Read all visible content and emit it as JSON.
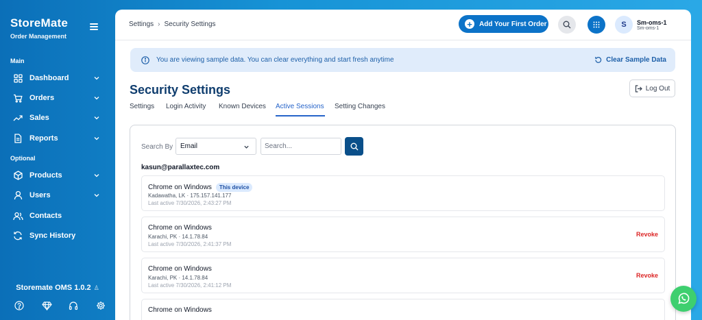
{
  "brand": {
    "name": "StoreMate",
    "subtitle": "Order Management"
  },
  "sidebar": {
    "sections": [
      {
        "label": "Main"
      },
      {
        "label": "Optional"
      }
    ],
    "items": [
      {
        "label": "Dashboard",
        "icon": "grid-icon",
        "has_chevron": true
      },
      {
        "label": "Orders",
        "icon": "cart-icon",
        "has_chevron": true
      },
      {
        "label": "Sales",
        "icon": "trending-up-icon",
        "has_chevron": true
      },
      {
        "label": "Reports",
        "icon": "document-icon",
        "has_chevron": true
      },
      {
        "label": "Products",
        "icon": "box-icon",
        "has_chevron": true
      },
      {
        "label": "Users",
        "icon": "user-icon",
        "has_chevron": true
      },
      {
        "label": "Contacts",
        "icon": "contacts-icon",
        "has_chevron": false
      },
      {
        "label": "Sync History",
        "icon": "sync-icon",
        "has_chevron": false
      }
    ],
    "version": "Storemate OMS 1.0.2",
    "bottom_icons": [
      "help-icon",
      "diamond-icon",
      "headset-icon",
      "settings-icon"
    ]
  },
  "header": {
    "breadcrumb": [
      "Settings",
      "Security Settings"
    ],
    "add_order_label": "Add Your First Order",
    "user_name": "Sm-oms-1",
    "user_sub": "Sm-oms-1",
    "avatar_initial": "S"
  },
  "banner": {
    "text": "You are viewing sample data. You can clear everything and start fresh anytime",
    "clear_label": "Clear Sample Data"
  },
  "page": {
    "title": "Security Settings",
    "logout_label": "Log Out",
    "tabs": [
      {
        "label": "Settings",
        "active": false
      },
      {
        "label": "Login Activity",
        "active": false
      },
      {
        "label": "Known Devices",
        "active": false
      },
      {
        "label": "Active Sessions",
        "active": true
      },
      {
        "label": "Setting Changes",
        "active": false
      }
    ]
  },
  "filters": {
    "search_by_label": "Search By",
    "selected_field": "Email",
    "search_placeholder": "Search..."
  },
  "sessions": {
    "email": "kasun@parallaxtec.com",
    "items": [
      {
        "device": "Chrome on Windows",
        "badge": "This device",
        "location": "Kadawatha, LK · 175.157.141.177",
        "last_active": "Last active 7/30/2026, 2:43:27 PM",
        "action": ""
      },
      {
        "device": "Chrome on Windows",
        "badge": "",
        "location": "Karachi, PK · 14.1.78.84",
        "last_active": "Last active 7/30/2026, 2:41:37 PM",
        "action": "Revoke"
      },
      {
        "device": "Chrome on Windows",
        "badge": "",
        "location": "Karachi, PK · 14.1.78.84",
        "last_active": "Last active 7/30/2026, 2:41:12 PM",
        "action": "Revoke"
      },
      {
        "device": "Chrome on Windows",
        "badge": "",
        "location": "",
        "last_active": "",
        "action": ""
      }
    ]
  },
  "colors": {
    "sidebar_gradient_start": "#0b6fb8",
    "accent": "#0c73c8",
    "revoke": "#dc2626",
    "banner_bg": "#e0ecfb",
    "whatsapp": "#3ecf6f"
  }
}
